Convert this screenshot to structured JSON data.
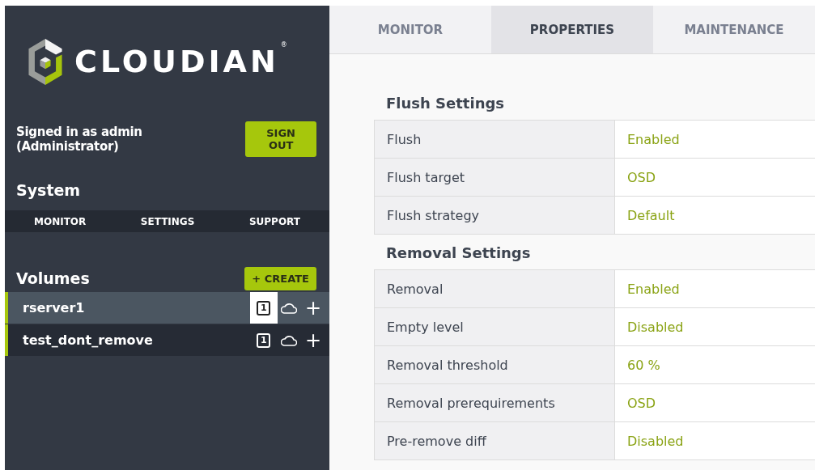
{
  "logo": {
    "wordmark": "CLOUDIAN",
    "mark": "®"
  },
  "account": {
    "signed_in": "Signed in as admin (Administrator)",
    "sign_out": "SIGN OUT"
  },
  "system": {
    "title": "System",
    "nav": [
      "MONITOR",
      "SETTINGS",
      "SUPPORT"
    ]
  },
  "volumes": {
    "title": "Volumes",
    "create": "+ CREATE",
    "items": [
      {
        "name": "rserver1",
        "selected": true,
        "badge": "1",
        "add": "+"
      },
      {
        "name": "test_dont_remove",
        "selected": false,
        "badge": "1",
        "add": "+"
      }
    ]
  },
  "tabs": [
    {
      "label": "MONITOR",
      "selected": false
    },
    {
      "label": "PROPERTIES",
      "selected": true
    },
    {
      "label": "MAINTENANCE",
      "selected": false
    }
  ],
  "sections": [
    {
      "title": "Flush Settings",
      "rows": [
        {
          "label": "Flush",
          "value": "Enabled"
        },
        {
          "label": "Flush target",
          "value": "OSD"
        },
        {
          "label": "Flush strategy",
          "value": "Default"
        }
      ]
    },
    {
      "title": "Removal Settings",
      "rows": [
        {
          "label": "Removal",
          "value": "Enabled"
        },
        {
          "label": "Empty level",
          "value": "Disabled"
        },
        {
          "label": "Removal threshold",
          "value": "60 %"
        },
        {
          "label": "Removal prerequirements",
          "value": "OSD"
        },
        {
          "label": "Pre-remove diff",
          "value": "Disabled"
        }
      ]
    }
  ]
}
